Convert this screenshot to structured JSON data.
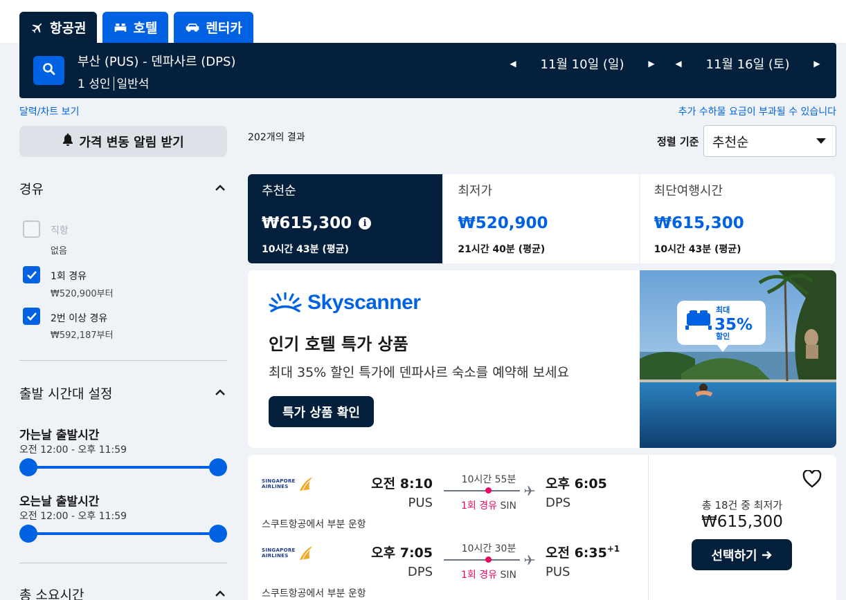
{
  "tabs": [
    {
      "label": "항공권",
      "icon": "plane-icon",
      "active": true
    },
    {
      "label": "호텔",
      "icon": "bed-icon"
    },
    {
      "label": "렌터카",
      "icon": "car-icon"
    }
  ],
  "search": {
    "route": "부산 (PUS) - 덴파사르 (DPS)",
    "passengers": "1 성인",
    "cabin": "일반석",
    "depart_date": "11월 10일 (일)",
    "return_date": "11월 16일 (토)"
  },
  "links": {
    "calendar": "달력/차트 보기",
    "baggage_notice": "추가 수하물 요금이 부과될 수 있습니다"
  },
  "sidebar": {
    "alert_button": "가격 변동 알림 받기",
    "stops": {
      "title": "경유",
      "options": [
        {
          "label": "직항",
          "sub": "없음",
          "checked": false,
          "disabled": true
        },
        {
          "label": "1회 경유",
          "sub": "₩520,900부터",
          "checked": true
        },
        {
          "label": "2번 이상 경유",
          "sub": "₩592,187부터",
          "checked": true
        }
      ]
    },
    "times": {
      "title": "출발 시간대 설정",
      "outbound_label": "가는날 출발시간",
      "outbound_range": "오전 12:00 - 오후 11:59",
      "return_label": "오는날 출발시간",
      "return_range": "오전 12:00 - 오후 11:59"
    },
    "duration_title": "총 소요시간"
  },
  "results": {
    "count": "202개의 결과",
    "sort_label": "정렬 기준",
    "sort_value": "추천순",
    "sort_tabs": [
      {
        "name": "추천순",
        "price": "₩615,300",
        "duration": "10시간 43분 (평균)",
        "active": true
      },
      {
        "name": "최저가",
        "price": "₩520,900",
        "duration": "21시간 40분 (평균)"
      },
      {
        "name": "최단여행시간",
        "price": "₩615,300",
        "duration": "10시간 43분 (평균)"
      }
    ]
  },
  "ad": {
    "brand": "Skyscanner",
    "title": "인기 호텔 특가 상품",
    "subtitle": "최대 35% 할인 특가에 덴파사르 숙소를 예약해 보세요",
    "button": "특가 상품 확인",
    "badge_top": "최대",
    "badge_pct": "35%",
    "badge_bottom": "할인"
  },
  "flight": {
    "airline_logo_text": [
      "SINGAPORE",
      "AIRLINES"
    ],
    "legs": [
      {
        "dep_time": "오전 8:10",
        "dep_code": "PUS",
        "duration": "10시간 55분",
        "stops": "1회 경유",
        "via": "SIN",
        "arr_time": "오후 6:05",
        "arr_code": "DPS",
        "day_offset": "",
        "operated": "스쿠트항공에서 부분 운항"
      },
      {
        "dep_time": "오후 7:05",
        "dep_code": "DPS",
        "duration": "10시간 30분",
        "stops": "1회 경유",
        "via": "SIN",
        "arr_time": "오전 6:35",
        "arr_code": "PUS",
        "day_offset": "+1",
        "operated": "스쿠트항공에서 부분 운항"
      }
    ],
    "deals_text": "총 18건 중 최저가",
    "price": "₩615,300",
    "select_button": "선택하기"
  },
  "colors": {
    "navy": "#05203c",
    "blue": "#0062e3",
    "pink": "#e70866",
    "background": "#eff3f8"
  }
}
